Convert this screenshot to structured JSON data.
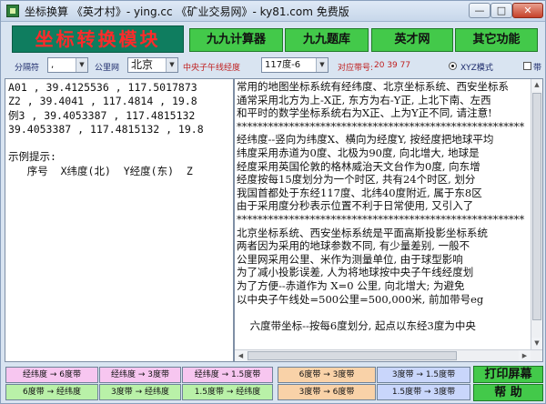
{
  "window": {
    "title": "坐标换算   《英才村》- ying.cc   《矿业交易网》- ky81.com   免费版",
    "minimize": "—",
    "maximize": "□",
    "close": "✕"
  },
  "header": {
    "logo": "坐标转换模块",
    "buttons": [
      "九九计算器",
      "九九题库",
      "英才网",
      "其它功能"
    ]
  },
  "options": {
    "separator_label": "分隔符",
    "separator_value": ",",
    "grid_label": "公里网",
    "grid_value": "北京",
    "meridian_label": "中央子午线经度",
    "meridian_value": "117度-6",
    "band_label": "对应带号:",
    "band_value": "20 39 77",
    "mode_label": "XYZ模式",
    "checkbox_label": "带"
  },
  "left_text": "A01 , 39.4125536 , 117.5017873\nZ2 , 39.4041 , 117.4814 , 19.8\n例3 , 39.4053387 , 117.4815132\n39.4053387 , 117.4815132 , 19.8\n\n示例提示:\n   序号  X纬度(北)  Y经度(东)  Z",
  "right_text": "常用的地图坐标系统有经纬度、北京坐标系统、西安坐标系\n通常采用北方为上-X正, 东方为右-Y正, 上北下南、左西\n和平时的数学坐标系统右为X正、上为Y正不同, 请注意!\n*******************************************************\n经纬度--竖向为纬度X、横向为经度Y, 按经度把地球平均\n纬度采用赤道为0度、北极为90度, 向北增大, 地球是\n经度采用英国伦敦的格林威治天文台作为0度, 向东增\n经度按每15度划分为一个时区, 共有24个时区, 划分\n我国首都处于东经117度、北纬40度附近, 属于东8区\n由于采用度分秒表示位置不利于日常使用, 又引入了\n*******************************************************\n北京坐标系统、西安坐标系统是平面高斯投影坐标系统\n两者因为采用的地球参数不同, 有少量差别, 一般不\n公里网采用公里、米作为测量单位, 由于球型影响\n为了减小投影误差, 人为将地球按中央子午线经度划\n为了方便--赤道作为 X=0 公里, 向北增大; 为避免\n以中央子午线处=500公里=500,000米, 前加带号eg\n\n    六度带坐标--按每6度划分, 起点以东经3度为中央",
  "converters": {
    "row1": [
      "经纬度 → 6度带",
      "经纬度 → 3度带",
      "经纬度 → 1.5度带",
      "6度带 → 3度带",
      "3度带 → 1.5度带"
    ],
    "row2": [
      "6度带 → 经纬度",
      "3度带 → 经纬度",
      "1.5度带 → 经纬度",
      "3度带 → 6度带",
      "1.5度带 → 3度带"
    ]
  },
  "actions": {
    "print": "打印屏幕",
    "help": "帮  助"
  }
}
